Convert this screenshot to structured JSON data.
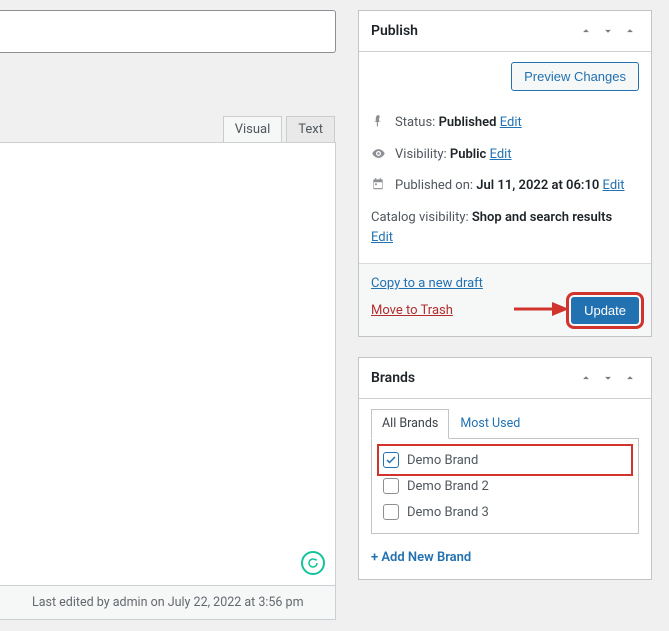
{
  "editor": {
    "tab_visual": "Visual",
    "tab_text": "Text",
    "footer": "Last edited by admin on July 22, 2022 at 3:56 pm"
  },
  "publish": {
    "title": "Publish",
    "preview": "Preview Changes",
    "status_label": "Status:",
    "status_value": "Published",
    "visibility_label": "Visibility:",
    "visibility_value": "Public",
    "published_label": "Published on:",
    "published_value": "Jul 11, 2022 at 06:10",
    "catalog_label": "Catalog visibility:",
    "catalog_value": "Shop and search results",
    "edit": "Edit",
    "copy_draft": "Copy to a new draft",
    "trash": "Move to Trash",
    "update": "Update"
  },
  "brands": {
    "title": "Brands",
    "tab_all": "All Brands",
    "tab_most": "Most Used",
    "items": [
      {
        "label": "Demo Brand",
        "checked": true,
        "highlight": true
      },
      {
        "label": "Demo Brand 2",
        "checked": false,
        "highlight": false
      },
      {
        "label": "Demo Brand 3",
        "checked": false,
        "highlight": false
      }
    ],
    "add_new": "+ Add New Brand"
  }
}
